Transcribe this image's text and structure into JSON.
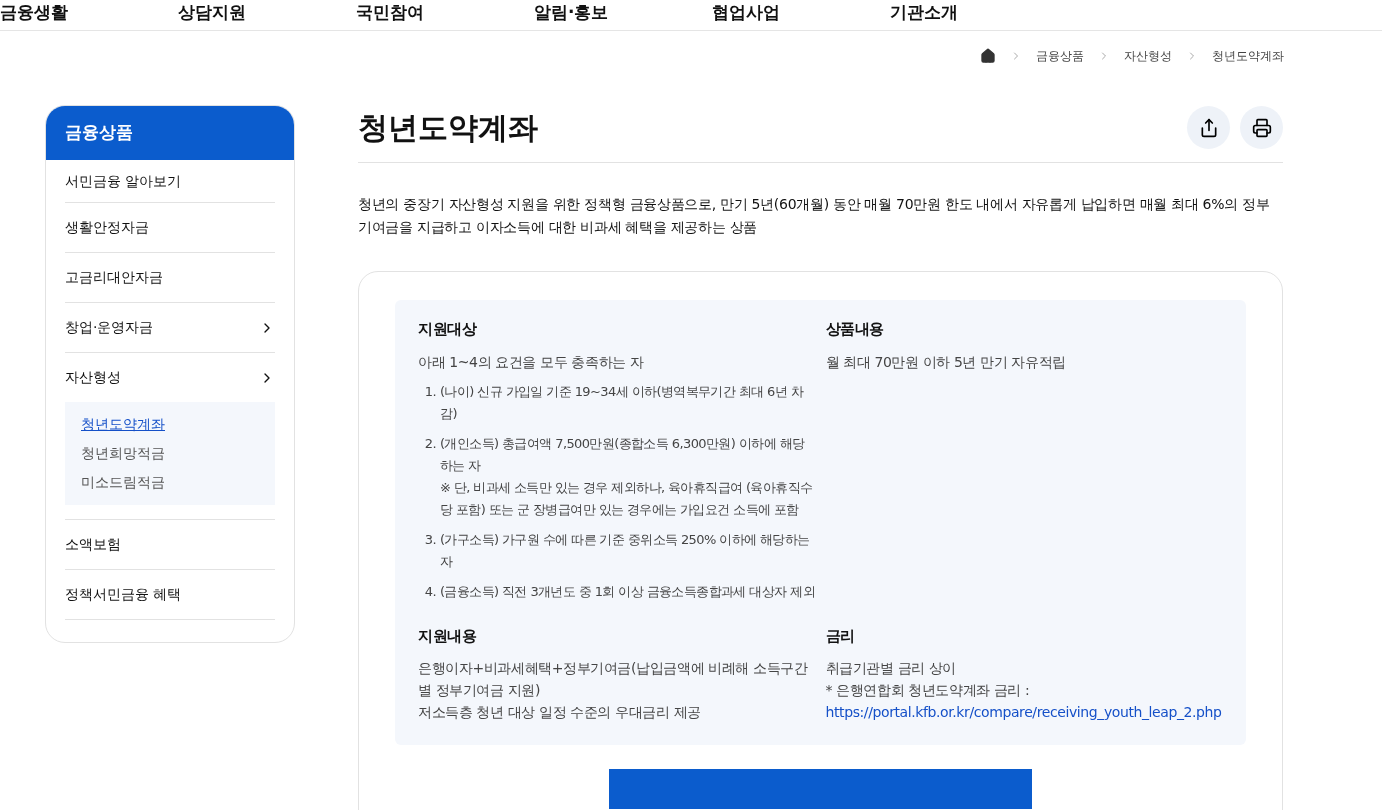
{
  "top_nav": [
    {
      "label": "금융생활"
    },
    {
      "label": "상담지원"
    },
    {
      "label": "국민참여"
    },
    {
      "label": "알림·홍보"
    },
    {
      "label": "협업사업"
    },
    {
      "label": "기관소개"
    }
  ],
  "breadcrumb": [
    "금융상품",
    "자산형성",
    "청년도약계좌"
  ],
  "sidebar": {
    "title": "금융상품",
    "items": [
      {
        "label": "서민금융 알아보기",
        "has_arrow": false
      },
      {
        "label": "생활안정자금",
        "has_arrow": false
      },
      {
        "label": "고금리대안자금",
        "has_arrow": false
      },
      {
        "label": "창업·운영자금",
        "has_arrow": true
      },
      {
        "label": "자산형성",
        "has_arrow": true,
        "children": [
          {
            "label": "청년도약계좌",
            "selected": true
          },
          {
            "label": "청년희망적금",
            "selected": false
          },
          {
            "label": "미소드림적금",
            "selected": false
          }
        ]
      },
      {
        "label": "소액보험",
        "has_arrow": false
      },
      {
        "label": "정책서민금융 혜택",
        "has_arrow": false
      }
    ]
  },
  "page_title": "청년도약계좌",
  "description": "청년의 중장기 자산형성 지원을 위한 정책형 금융상품으로, 만기 5년(60개월) 동안 매월 70만원 한도 내에서 자유롭게 납입하면 매월 최대 6%의 정부기여금을 지급하고 이자소득에 대한 비과세 혜택을 제공하는 상품",
  "sections": [
    {
      "title": "지원대상",
      "lines": [
        "아래 1~4의 요건을 모두 충족하는 자"
      ],
      "list": [
        {
          "number": "1.",
          "text": "(나이) 신규 가입일 기준 19~34세 이하(병역복무기간 최대 6년 차감)"
        },
        {
          "number": "2.",
          "text": "(개인소득) 총급여액 7,500만원(종합소득 6,300만원) 이하에 해당하는 자",
          "note": "※ 단, 비과세 소득만 있는 경우 제외하나, 육아휴직급여 (육아휴직수당 포함) 또는 군 장병급여만 있는 경우에는 가입요건 소득에 포함"
        },
        {
          "number": "3.",
          "text": "(가구소득) 가구원 수에 따른 기준 중위소득 250% 이하에 해당하는 자"
        },
        {
          "number": "4.",
          "text": "(금융소득) 직전 3개년도 중 1회 이상 금융소득종합과세 대상자 제외"
        }
      ]
    },
    {
      "title": "상품내용",
      "lines": [
        "월 최대 70만원 이하 5년 만기 자유적립"
      ]
    },
    {
      "title": "지원내용",
      "lines": [
        "은행이자+비과세혜택+정부기여금(납입금액에 비례해 소득구간별 정부기여금 지원)",
        "저소득층 청년 대상 일정 수준의 우대금리 제공"
      ]
    },
    {
      "title": "금리",
      "lines": [
        "취급기관별 금리 상이"
      ],
      "link_prefix": "* 은행연합회 청년도약계좌 금리 : ",
      "link": "https://portal.kfb.or.kr/compare/receiving_youth_leap_2.php"
    }
  ]
}
